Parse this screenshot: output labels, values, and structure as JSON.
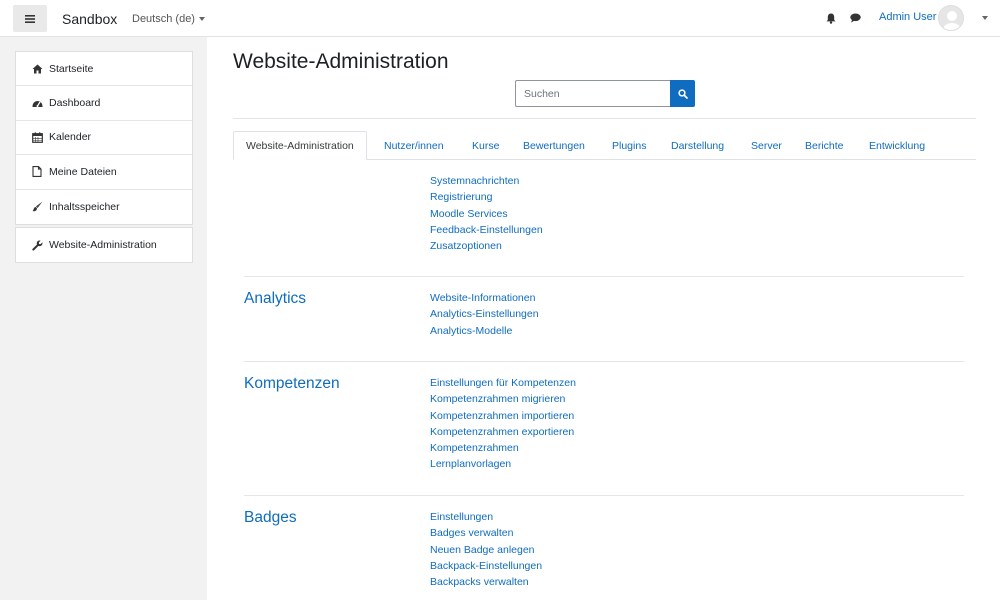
{
  "navbar": {
    "brand": "Sandbox",
    "language": "Deutsch (de)",
    "user_name": "Admin User"
  },
  "drawer": {
    "items": [
      {
        "label": "Startseite",
        "icon": "home-icon"
      },
      {
        "label": "Dashboard",
        "icon": "dashboard-icon"
      },
      {
        "label": "Kalender",
        "icon": "calendar-icon"
      },
      {
        "label": "Meine Dateien",
        "icon": "file-icon"
      },
      {
        "label": "Inhaltsspeicher",
        "icon": "paintbrush-icon"
      }
    ],
    "admin_item": {
      "label": "Website-Administration",
      "icon": "wrench-icon"
    }
  },
  "main": {
    "title": "Website-Administration",
    "search": {
      "placeholder": "Suchen"
    },
    "tabs": [
      "Website-Administration",
      "Nutzer/innen",
      "Kurse",
      "Bewertungen",
      "Plugins",
      "Darstellung",
      "Server",
      "Berichte",
      "Entwicklung"
    ],
    "sections": [
      {
        "heading": "",
        "links": [
          "Systemnachrichten",
          "Registrierung",
          "Moodle Services",
          "Feedback-Einstellungen",
          "Zusatzoptionen"
        ]
      },
      {
        "heading": "Analytics",
        "links": [
          "Website-Informationen",
          "Analytics-Einstellungen",
          "Analytics-Modelle"
        ]
      },
      {
        "heading": "Kompetenzen",
        "links": [
          "Einstellungen für Kompetenzen",
          "Kompetenzrahmen migrieren",
          "Kompetenzrahmen importieren",
          "Kompetenzrahmen exportieren",
          "Kompetenzrahmen",
          "Lernplanvorlagen"
        ]
      },
      {
        "heading": "Badges",
        "links": [
          "Einstellungen",
          "Badges verwalten",
          "Neuen Badge anlegen",
          "Backpack-Einstellungen",
          "Backpacks verwalten"
        ]
      }
    ]
  },
  "colors": {
    "accent": "#0f6cbf",
    "drawer_bg": "#f2f2f2"
  }
}
